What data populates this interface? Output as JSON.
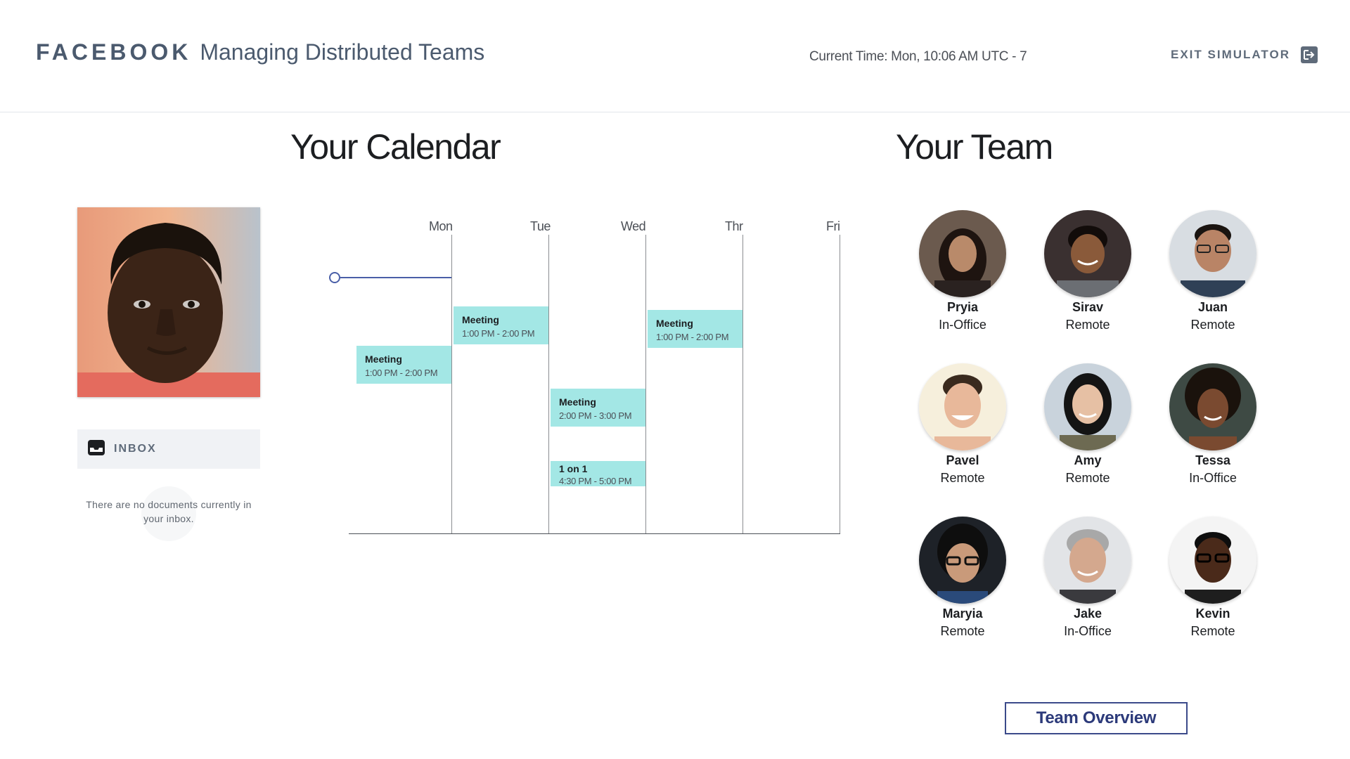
{
  "header": {
    "brand": "FACEBOOK",
    "title": "Managing Distributed Teams",
    "current_time": "Current Time: Mon, 10:06 AM UTC - 7",
    "exit_label": "EXIT SIMULATOR"
  },
  "calendar": {
    "title": "Your Calendar",
    "days": [
      "Mon",
      "Tue",
      "Wed",
      "Thr",
      "Fri"
    ],
    "events": [
      {
        "title": "Meeting",
        "time": "1:00 PM - 2:00 PM"
      },
      {
        "title": "Meeting",
        "time": "1:00 PM - 2:00 PM"
      },
      {
        "title": "Meeting",
        "time": "2:00 PM - 3:00 PM"
      },
      {
        "title": "1 on 1",
        "time": "4:30 PM - 5:00 PM"
      },
      {
        "title": "Meeting",
        "time": "1:00 PM - 2:00 PM"
      }
    ]
  },
  "inbox": {
    "label": "INBOX",
    "empty_message": "There are no documents currently in your inbox."
  },
  "team": {
    "title": "Your Team",
    "members": [
      {
        "name": "Pryia",
        "status": "In-Office"
      },
      {
        "name": "Sirav",
        "status": "Remote"
      },
      {
        "name": "Juan",
        "status": "Remote"
      },
      {
        "name": "Pavel",
        "status": "Remote"
      },
      {
        "name": "Amy",
        "status": "Remote"
      },
      {
        "name": "Tessa",
        "status": "In-Office"
      },
      {
        "name": "Maryia",
        "status": "Remote"
      },
      {
        "name": "Jake",
        "status": "In-Office"
      },
      {
        "name": "Kevin",
        "status": "Remote"
      }
    ],
    "overview_button": "Team Overview"
  },
  "colors": {
    "event_bg": "#a3e7e5",
    "brand_gray": "#4b5a6e",
    "button_blue": "#2c3a7a",
    "now_line": "#4a5fa8"
  },
  "icons": [
    "exit-arrow-icon",
    "inbox-tray-icon"
  ]
}
